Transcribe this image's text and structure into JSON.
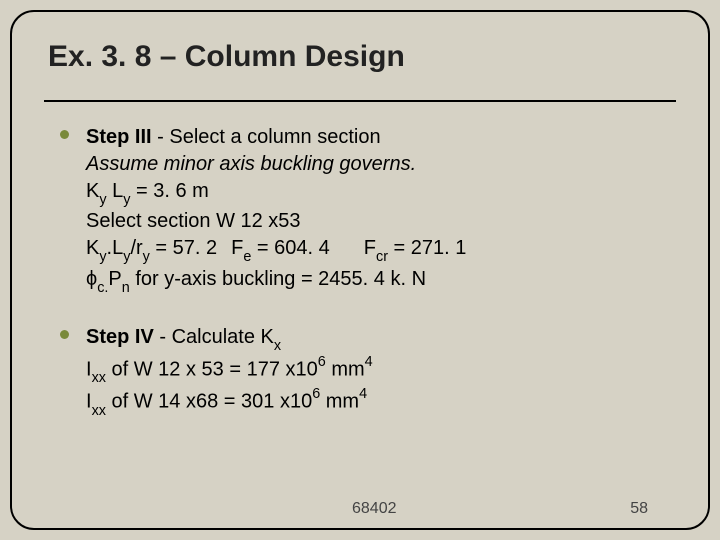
{
  "title": "Ex. 3. 8 – Column Design",
  "step3": {
    "heading_bold": "Step III",
    "heading_rest": " - Select a column section",
    "assume": "Assume minor axis buckling governs.",
    "kyly_label_ky": "K",
    "kyly_sub_y1": "y",
    "kyly_label_ly": " L",
    "kyly_sub_y2": "y",
    "kyly_eq": " = 3. 6 m",
    "select_section": "Select section W 12 x53",
    "ratio_ky": "K",
    "ratio_y1": "y",
    "ratio_dot": ".L",
    "ratio_y2": "y",
    "ratio_slash_r": "/r",
    "ratio_y3": "y",
    "ratio_val": " = 57. 2",
    "fe_label": "F",
    "fe_sub": "e",
    "fe_val": " = 604. 4",
    "fcr_label": "F",
    "fcr_sub": "cr",
    "fcr_val": " = 271. 1",
    "phi": "ϕ",
    "phi_sub": "c.",
    "pn_p": "P",
    "pn_n": "n",
    "phi_rest": " for y-axis buckling = 2455. 4 k. N"
  },
  "step4": {
    "heading_bold": "Step IV",
    "heading_rest": " - Calculate K",
    "heading_sub_x": "x",
    "ixx1_I": "I",
    "ixx1_sub": "xx",
    "ixx1_mid": " of W 12 x 53 = 177 x10",
    "ixx1_sup": "6",
    "ixx1_unit": " mm",
    "ixx1_unitsup": "4",
    "ixx2_I": "I",
    "ixx2_sub": "xx",
    "ixx2_mid": " of W 14 x68 = 301 x10",
    "ixx2_sup": "6",
    "ixx2_unit": " mm",
    "ixx2_unitsup": "4"
  },
  "footer": {
    "course": "68402",
    "page": "58"
  }
}
